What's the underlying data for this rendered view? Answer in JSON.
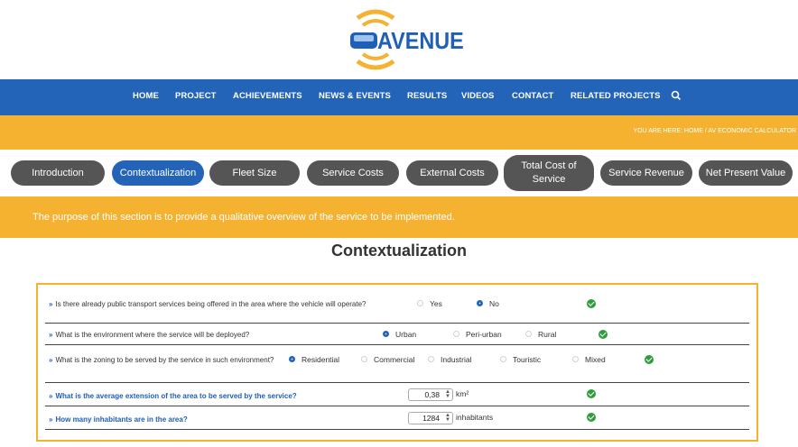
{
  "brand": {
    "logo_text": "AVENUE"
  },
  "nav": {
    "items": [
      "HOME",
      "PROJECT",
      "ACHIEVEMENTS",
      "NEWS & EVENTS",
      "RESULTS",
      "VIDEOS",
      "CONTACT",
      "RELATED PROJECTS"
    ],
    "search_icon": "search-icon"
  },
  "breadcrumb": {
    "text": "YOU ARE HERE:  HOME  /  AV ECONOMIC CALCULATOR"
  },
  "tabs": [
    "Introduction",
    "Contextualization",
    "Fleet Size",
    "Service Costs",
    "External Costs",
    "Total Cost of Service",
    "Service Revenue",
    "Net Present Value"
  ],
  "active_tab": "Contextualization",
  "info": {
    "text": "The purpose of this section is to provide a qualitative overview of the service to be implemented."
  },
  "section_title": "Contextualization",
  "questions": [
    {
      "arrows": "»",
      "text": "Is there already public transport services being offered in the area where the vehicle will operate?",
      "options": [
        "Yes",
        "No"
      ],
      "selected": "No"
    },
    {
      "arrows": "»",
      "text": "What is the environment where the service will be deployed?",
      "options": [
        "Urban",
        "Peri-urban",
        "Rural"
      ],
      "selected": "Urban"
    },
    {
      "arrows": "»",
      "text": "What is the zoning to be served by the service in such environment?",
      "options": [
        "Residential",
        "Commercial",
        "Industrial",
        "Touristic",
        "Mixed"
      ],
      "selected": "Residential"
    },
    {
      "arrows": "»",
      "text": "What is the average extension of the area to be served by the service?",
      "value": "0,38",
      "unit": "km²"
    },
    {
      "arrows": "»",
      "text": "How many inhabitants are in the area?",
      "value": "1284",
      "unit": "inhabitants"
    }
  ],
  "colors": {
    "nav_blue": "#2364b8",
    "accent_orange": "#f5b130",
    "tab_gray": "#555555",
    "check_green": "#2e9e3d"
  }
}
